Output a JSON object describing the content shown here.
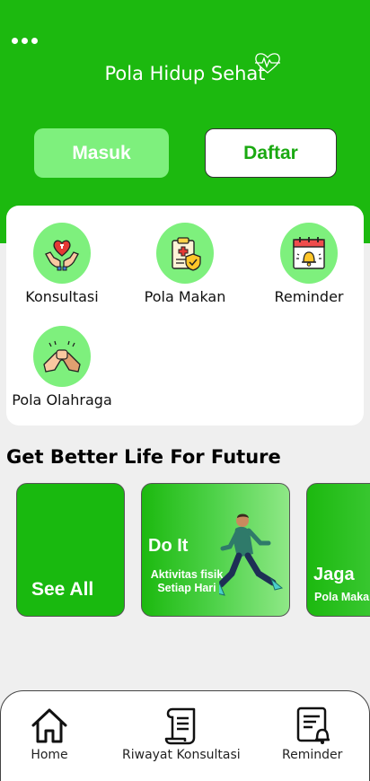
{
  "header": {
    "title": "Pola Hidup Sehat",
    "login_label": "Masuk",
    "register_label": "Daftar",
    "bg_color": "#1cb90f"
  },
  "menu": {
    "items": [
      {
        "label": "Konsultasi",
        "icon": "heart-hands-icon"
      },
      {
        "label": "Pola Makan",
        "icon": "clipboard-shield-icon"
      },
      {
        "label": "Reminder",
        "icon": "calendar-bell-icon"
      },
      {
        "label": "Pola Olahraga",
        "icon": "arm-wrestling-icon"
      }
    ]
  },
  "section": {
    "title": "Get Better Life For Future"
  },
  "banners": [
    {
      "title": "See All",
      "subtitle": ""
    },
    {
      "title": "Do It",
      "subtitle": "Aktivitas fisik Setiap Hari"
    },
    {
      "title": "Jaga",
      "subtitle": "Pola Makan"
    }
  ],
  "bottom_nav": {
    "items": [
      {
        "label": "Home",
        "icon": "home-icon"
      },
      {
        "label": "Riwayat Konsultasi",
        "icon": "scroll-icon"
      },
      {
        "label": "Reminder",
        "icon": "bell-list-icon"
      }
    ]
  }
}
